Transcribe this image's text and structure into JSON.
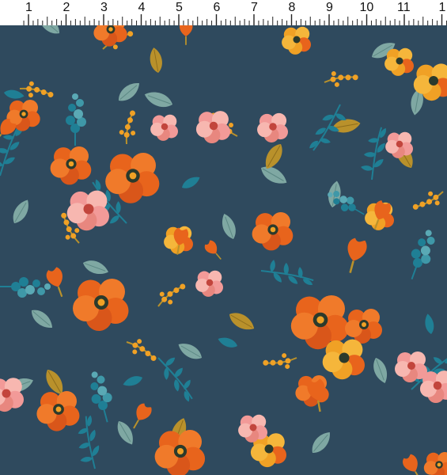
{
  "ruler": {
    "unit_labels": [
      "1",
      "2",
      "3",
      "4",
      "5",
      "6",
      "7",
      "8",
      "9",
      "10",
      "11",
      "1"
    ]
  },
  "fabric": {
    "colors": {
      "ground": "#2f4a5e",
      "orange": "#e8641c",
      "orange_dark": "#c94a12",
      "gold": "#f0a125",
      "pink": "#f29a98",
      "pink_light": "#f7b7b0",
      "teal": "#1f7f95",
      "sage": "#7fa8a3",
      "mustard": "#b9912b",
      "center": "#2b3a2c"
    }
  }
}
